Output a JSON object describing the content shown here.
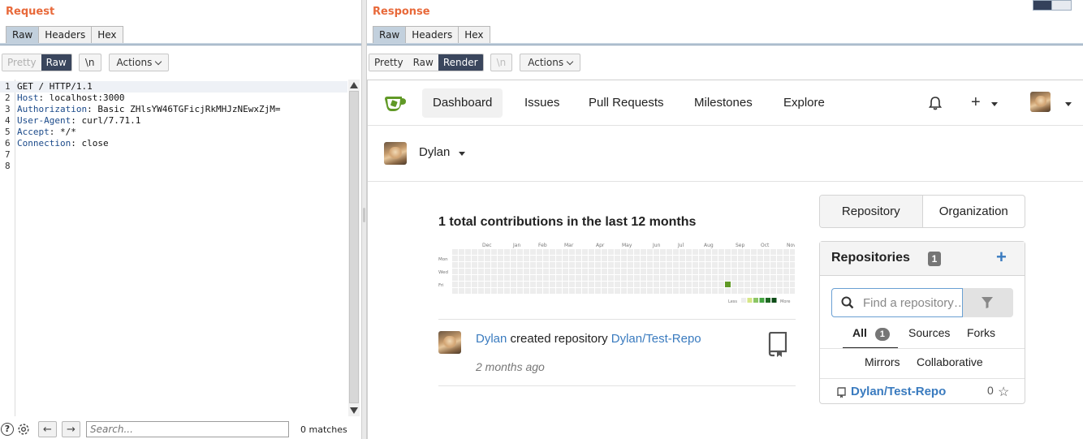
{
  "request": {
    "title": "Request",
    "tabs": [
      "Raw",
      "Headers",
      "Hex"
    ],
    "active_tab": 0,
    "toolbar": {
      "pretty": "Pretty",
      "raw": "Raw",
      "newline": "\\n",
      "actions": "Actions"
    },
    "lines": [
      {
        "n": "1",
        "key": "GET / HTTP/1.1",
        "val": ""
      },
      {
        "n": "2",
        "key": "Host",
        "val": ": localhost:3000"
      },
      {
        "n": "3",
        "key": "Authorization",
        "val": ": Basic ZHlsYW46TGFicjRkMHJzNEwxZjM="
      },
      {
        "n": "4",
        "key": "User-Agent",
        "val": ": curl/7.71.1"
      },
      {
        "n": "5",
        "key": "Accept",
        "val": ": */*"
      },
      {
        "n": "6",
        "key": "Connection",
        "val": ": close"
      },
      {
        "n": "7",
        "key": "",
        "val": ""
      },
      {
        "n": "8",
        "key": "",
        "val": ""
      }
    ],
    "bottom": {
      "help": "?",
      "search_placeholder": "Search...",
      "matches": "0 matches",
      "prev": "←",
      "next": "→"
    }
  },
  "response": {
    "title": "Response",
    "tabs": [
      "Raw",
      "Headers",
      "Hex"
    ],
    "active_tab": 0,
    "toolbar": {
      "pretty": "Pretty",
      "raw": "Raw",
      "render": "Render",
      "newline": "\\n",
      "actions": "Actions"
    },
    "page": {
      "nav": [
        "Dashboard",
        "Issues",
        "Pull Requests",
        "Milestones",
        "Explore"
      ],
      "active_nav": "Dashboard",
      "plus": "+",
      "context_user": "Dylan",
      "heatmap": {
        "title": "1 total contributions in the last 12 months",
        "months": [
          "Dec",
          "Jan",
          "Feb",
          "Mar",
          "Apr",
          "May",
          "Jun",
          "Jul",
          "Aug",
          "Sep",
          "Oct",
          "Nov"
        ],
        "days": [
          "Mon",
          "Wed",
          "Fri"
        ],
        "less": "Less",
        "more": "More"
      },
      "feed": {
        "user": "Dylan",
        "action": " created repository ",
        "repo": "Dylan/Test-Repo",
        "time": "2 months ago"
      },
      "side_tabs": [
        "Repository",
        "Organization"
      ],
      "repos": {
        "title": "Repositories",
        "count": "1",
        "add": "+",
        "search_placeholder": "Find a repository…",
        "filters": {
          "all": "All",
          "all_count": "1",
          "sources": "Sources",
          "forks": "Forks",
          "mirrors": "Mirrors",
          "collaborative": "Collaborative"
        },
        "items": [
          {
            "name": "Dylan/Test-Repo",
            "stars": "0"
          }
        ]
      }
    }
  },
  "colors": {
    "accent": "#e8693a",
    "tab_active": "#c2d0dd",
    "toggle_on": "#3a465d",
    "link": "#3a7bbf",
    "heat_empty": "#ededed",
    "heat_1": "#609926"
  }
}
